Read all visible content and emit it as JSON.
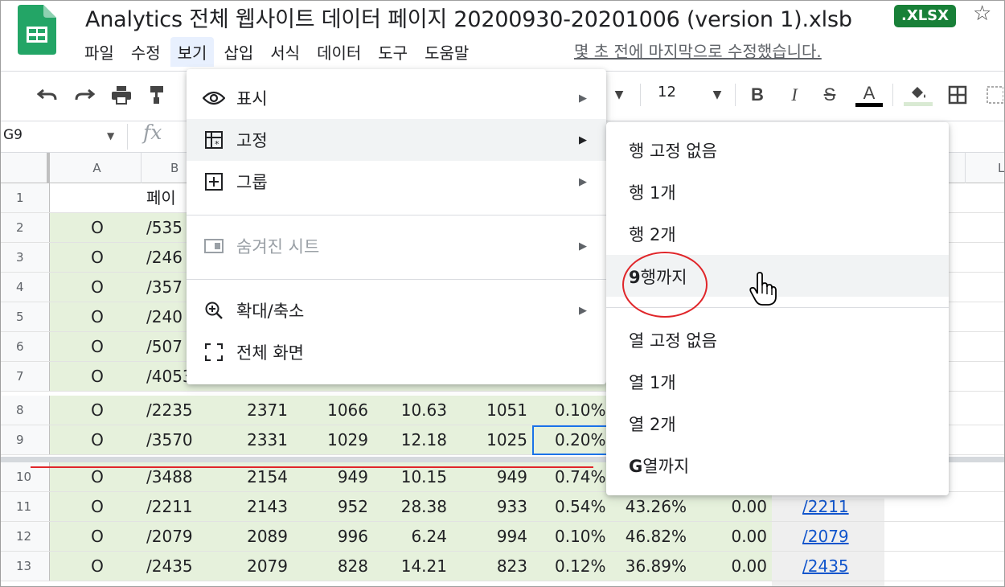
{
  "app": {
    "doc_title": "Analytics 전체 웹사이트 데이터 페이지 20200930-20201006 (version 1).xlsb",
    "file_badge": ".XLSX",
    "last_edit": "몇 초 전에 마지막으로 수정했습니다."
  },
  "menubar": [
    "파일",
    "수정",
    "보기",
    "삽입",
    "서식",
    "데이터",
    "도구",
    "도움말"
  ],
  "toolbar": {
    "font_size": "12",
    "icons": [
      "undo-icon",
      "redo-icon",
      "print-icon",
      "paint-format-icon",
      "dropdown-icon",
      "bold-icon",
      "italic-icon",
      "strikethrough-icon",
      "text-color-icon",
      "fill-color-icon",
      "borders-icon",
      "merge-icon"
    ]
  },
  "formula_bar": {
    "cell_ref": "G9",
    "fx": "fx"
  },
  "grid": {
    "col_headers": [
      "A",
      "B",
      "L"
    ],
    "header_row_b": "페이",
    "row_numbers": [
      "1",
      "2",
      "3",
      "4",
      "5",
      "6",
      "7",
      "8",
      "9",
      "10",
      "11",
      "12",
      "13"
    ],
    "partial_rows": [
      {
        "a": "O",
        "b": "/535"
      },
      {
        "a": "O",
        "b": "/246"
      },
      {
        "a": "O",
        "b": "/357"
      },
      {
        "a": "O",
        "b": "/240"
      },
      {
        "a": "O",
        "b": "/507"
      },
      {
        "a": "O",
        "b": "/4053"
      }
    ],
    "full_rows": [
      {
        "a": "O",
        "b": "/2235",
        "c": "2371",
        "d": "1066",
        "e": "10.63",
        "f": "1051",
        "g": "0.10%",
        "h": "",
        "i": "",
        "link": ""
      },
      {
        "a": "O",
        "b": "/3570",
        "c": "2331",
        "d": "1029",
        "e": "12.18",
        "f": "1025",
        "g": "0.20%",
        "h": "",
        "i": "",
        "link": ""
      },
      {
        "a": "O",
        "b": "/3488",
        "c": "2154",
        "d": "949",
        "e": "10.15",
        "f": "949",
        "g": "0.74%",
        "h": "",
        "i": "",
        "link": ""
      },
      {
        "a": "O",
        "b": "/2211",
        "c": "2143",
        "d": "952",
        "e": "28.38",
        "f": "933",
        "g": "0.54%",
        "h": "43.26%",
        "i": "0.00",
        "link": "/2211"
      },
      {
        "a": "O",
        "b": "/2079",
        "c": "2089",
        "d": "996",
        "e": "6.24",
        "f": "994",
        "g": "0.10%",
        "h": "46.82%",
        "i": "0.00",
        "link": "/2079"
      },
      {
        "a": "O",
        "b": "/2435",
        "c": "2079",
        "d": "828",
        "e": "14.21",
        "f": "823",
        "g": "0.12%",
        "h": "36.89%",
        "i": "0.00",
        "link": "/2435"
      }
    ]
  },
  "view_menu": {
    "items": [
      {
        "label": "표시",
        "icon": "eye-icon"
      },
      {
        "label": "고정",
        "icon": "freeze-icon"
      },
      {
        "label": "그룹",
        "icon": "group-icon"
      },
      {
        "label": "숨겨진 시트",
        "icon": "hidden-sheet-icon"
      },
      {
        "label": "확대/축소",
        "icon": "zoom-icon"
      },
      {
        "label": "전체 화면",
        "icon": "fullscreen-icon"
      }
    ]
  },
  "freeze_submenu": {
    "items": [
      {
        "label": "행 고정 없음"
      },
      {
        "label": "행 1개"
      },
      {
        "label": "행 2개"
      },
      {
        "label_bold": "9",
        "label": "행까지"
      },
      {
        "label": "열 고정 없음"
      },
      {
        "label": "열 1개"
      },
      {
        "label": "열 2개"
      },
      {
        "label_bold": "G",
        "label": "열까지"
      }
    ]
  },
  "colors": {
    "accent": "#1a73e8",
    "brand": "#188038",
    "highlight_row": "#e6f1dc",
    "annotation": "#e0262a"
  }
}
